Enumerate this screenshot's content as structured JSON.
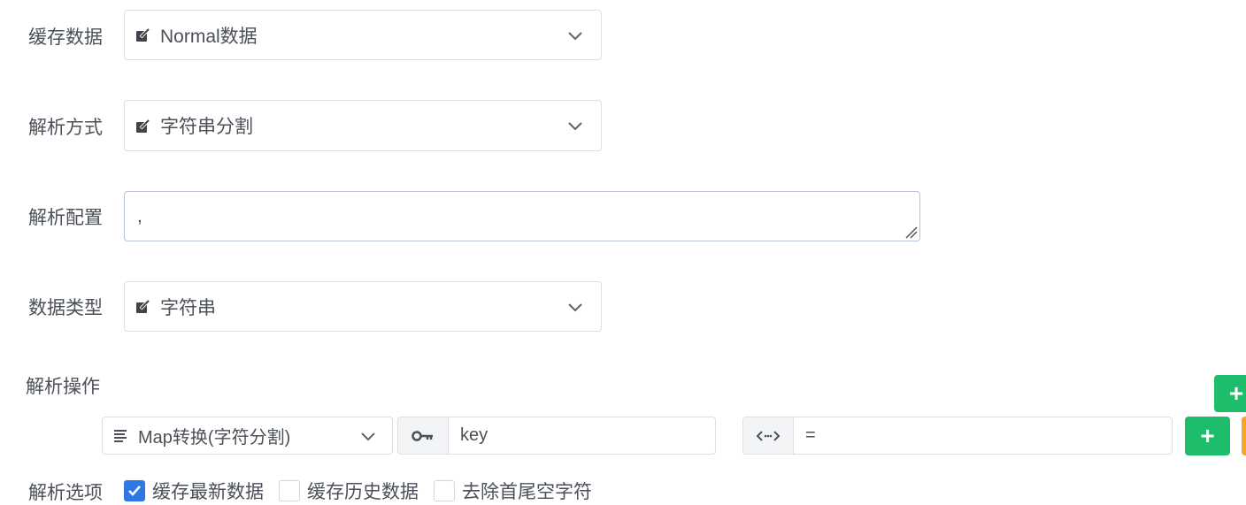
{
  "cache_data": {
    "label": "缓存数据",
    "value": "Normal数据"
  },
  "parse_method": {
    "label": "解析方式",
    "value": "字符串分割"
  },
  "parse_config": {
    "label": "解析配置",
    "value": ","
  },
  "data_type": {
    "label": "数据类型",
    "value": "字符串"
  },
  "parse_operation": {
    "label": "解析操作",
    "row": {
      "operation_value": "Map转换(字符分割)",
      "key_value": "key",
      "separator_value": "=",
      "add_symbol": "+"
    },
    "add_symbol": "+"
  },
  "parse_options": {
    "label": "解析选项",
    "items": [
      {
        "label": "缓存最新数据",
        "checked": true
      },
      {
        "label": "缓存历史数据",
        "checked": false
      },
      {
        "label": "去除首尾空字符",
        "checked": false
      }
    ]
  },
  "colors": {
    "green": "#1dbd6c",
    "orange": "#f5a623",
    "checkbox_blue": "#2e78e6"
  }
}
